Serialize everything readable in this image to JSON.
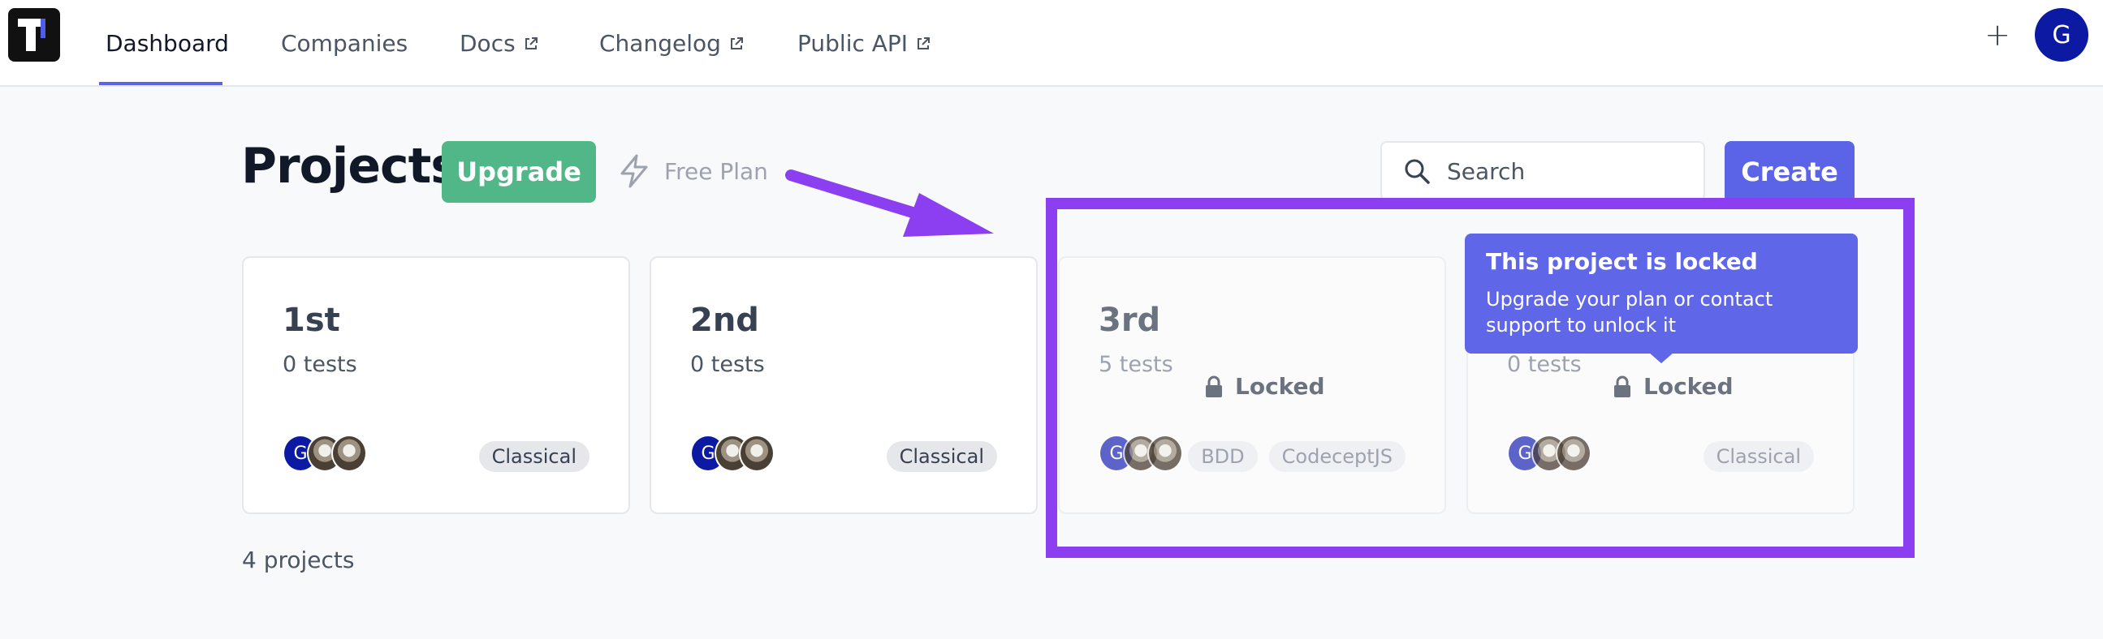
{
  "nav": {
    "items": [
      {
        "label": "Dashboard",
        "external": false,
        "active": true
      },
      {
        "label": "Companies",
        "external": false,
        "active": false
      },
      {
        "label": "Docs",
        "external": true,
        "active": false
      },
      {
        "label": "Changelog",
        "external": true,
        "active": false
      },
      {
        "label": "Public API",
        "external": true,
        "active": false
      }
    ],
    "add_label": "+",
    "user_initial": "G"
  },
  "header": {
    "title": "Projects",
    "upgrade_label": "Upgrade",
    "plan_label": "Free Plan",
    "search_placeholder": "Search",
    "create_label": "Create"
  },
  "projects": [
    {
      "name": "1st",
      "tests": "0 tests",
      "locked": false,
      "tags": [
        "Classical"
      ]
    },
    {
      "name": "2nd",
      "tests": "0 tests",
      "locked": false,
      "tags": [
        "Classical"
      ]
    },
    {
      "name": "3rd",
      "tests": "5 tests",
      "locked": true,
      "locked_label": "Locked",
      "tags": [
        "BDD",
        "CodeceptJS"
      ]
    },
    {
      "name": "",
      "tests": "0 tests",
      "locked": true,
      "locked_label": "Locked",
      "tags": [
        "Classical"
      ]
    }
  ],
  "avatars": {
    "user_initial": "G"
  },
  "footer": {
    "count": "4 projects"
  },
  "tooltip": {
    "title": "This project is locked",
    "body": "Upgrade your plan or contact support to unlock it"
  },
  "colors": {
    "accent": "#5b63e6",
    "upgrade": "#52b788",
    "annotation": "#8b3ff0",
    "avatar": "#0c1aa3"
  }
}
